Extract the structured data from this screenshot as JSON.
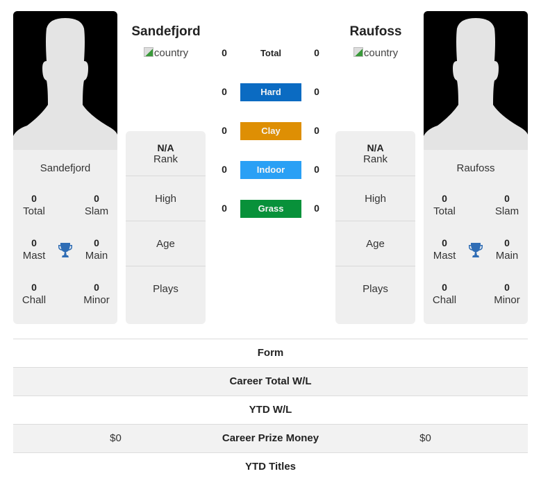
{
  "players": {
    "left": {
      "name": "Sandefjord",
      "flag_alt": "country",
      "card_name": "Sandefjord",
      "stats": {
        "total": {
          "value": "0",
          "label": "Total"
        },
        "slam": {
          "value": "0",
          "label": "Slam"
        },
        "mast": {
          "value": "0",
          "label": "Mast"
        },
        "main": {
          "value": "0",
          "label": "Main"
        },
        "chall": {
          "value": "0",
          "label": "Chall"
        },
        "minor": {
          "value": "0",
          "label": "Minor"
        }
      },
      "info": {
        "rank_value": "N/A",
        "rank_label": "Rank",
        "high_label": "High",
        "age_label": "Age",
        "plays_label": "Plays"
      }
    },
    "right": {
      "name": "Raufoss",
      "flag_alt": "country",
      "card_name": "Raufoss",
      "stats": {
        "total": {
          "value": "0",
          "label": "Total"
        },
        "slam": {
          "value": "0",
          "label": "Slam"
        },
        "mast": {
          "value": "0",
          "label": "Mast"
        },
        "main": {
          "value": "0",
          "label": "Main"
        },
        "chall": {
          "value": "0",
          "label": "Chall"
        },
        "minor": {
          "value": "0",
          "label": "Minor"
        }
      },
      "info": {
        "rank_value": "N/A",
        "rank_label": "Rank",
        "high_label": "High",
        "age_label": "Age",
        "plays_label": "Plays"
      }
    }
  },
  "surfaces": [
    {
      "label": "Total",
      "left": "0",
      "right": "0",
      "color": ""
    },
    {
      "label": "Hard",
      "left": "0",
      "right": "0",
      "color": "#0b6bc2"
    },
    {
      "label": "Clay",
      "left": "0",
      "right": "0",
      "color": "#de8f04"
    },
    {
      "label": "Indoor",
      "left": "0",
      "right": "0",
      "color": "#2aa0f5"
    },
    {
      "label": "Grass",
      "left": "0",
      "right": "0",
      "color": "#08913a"
    }
  ],
  "comparison": [
    {
      "label": "Form",
      "left": "",
      "right": ""
    },
    {
      "label": "Career Total W/L",
      "left": "",
      "right": ""
    },
    {
      "label": "YTD W/L",
      "left": "",
      "right": ""
    },
    {
      "label": "Career Prize Money",
      "left": "$0",
      "right": "$0"
    },
    {
      "label": "YTD Titles",
      "left": "",
      "right": ""
    }
  ],
  "colors": {
    "trophy": "#2f6db5"
  }
}
